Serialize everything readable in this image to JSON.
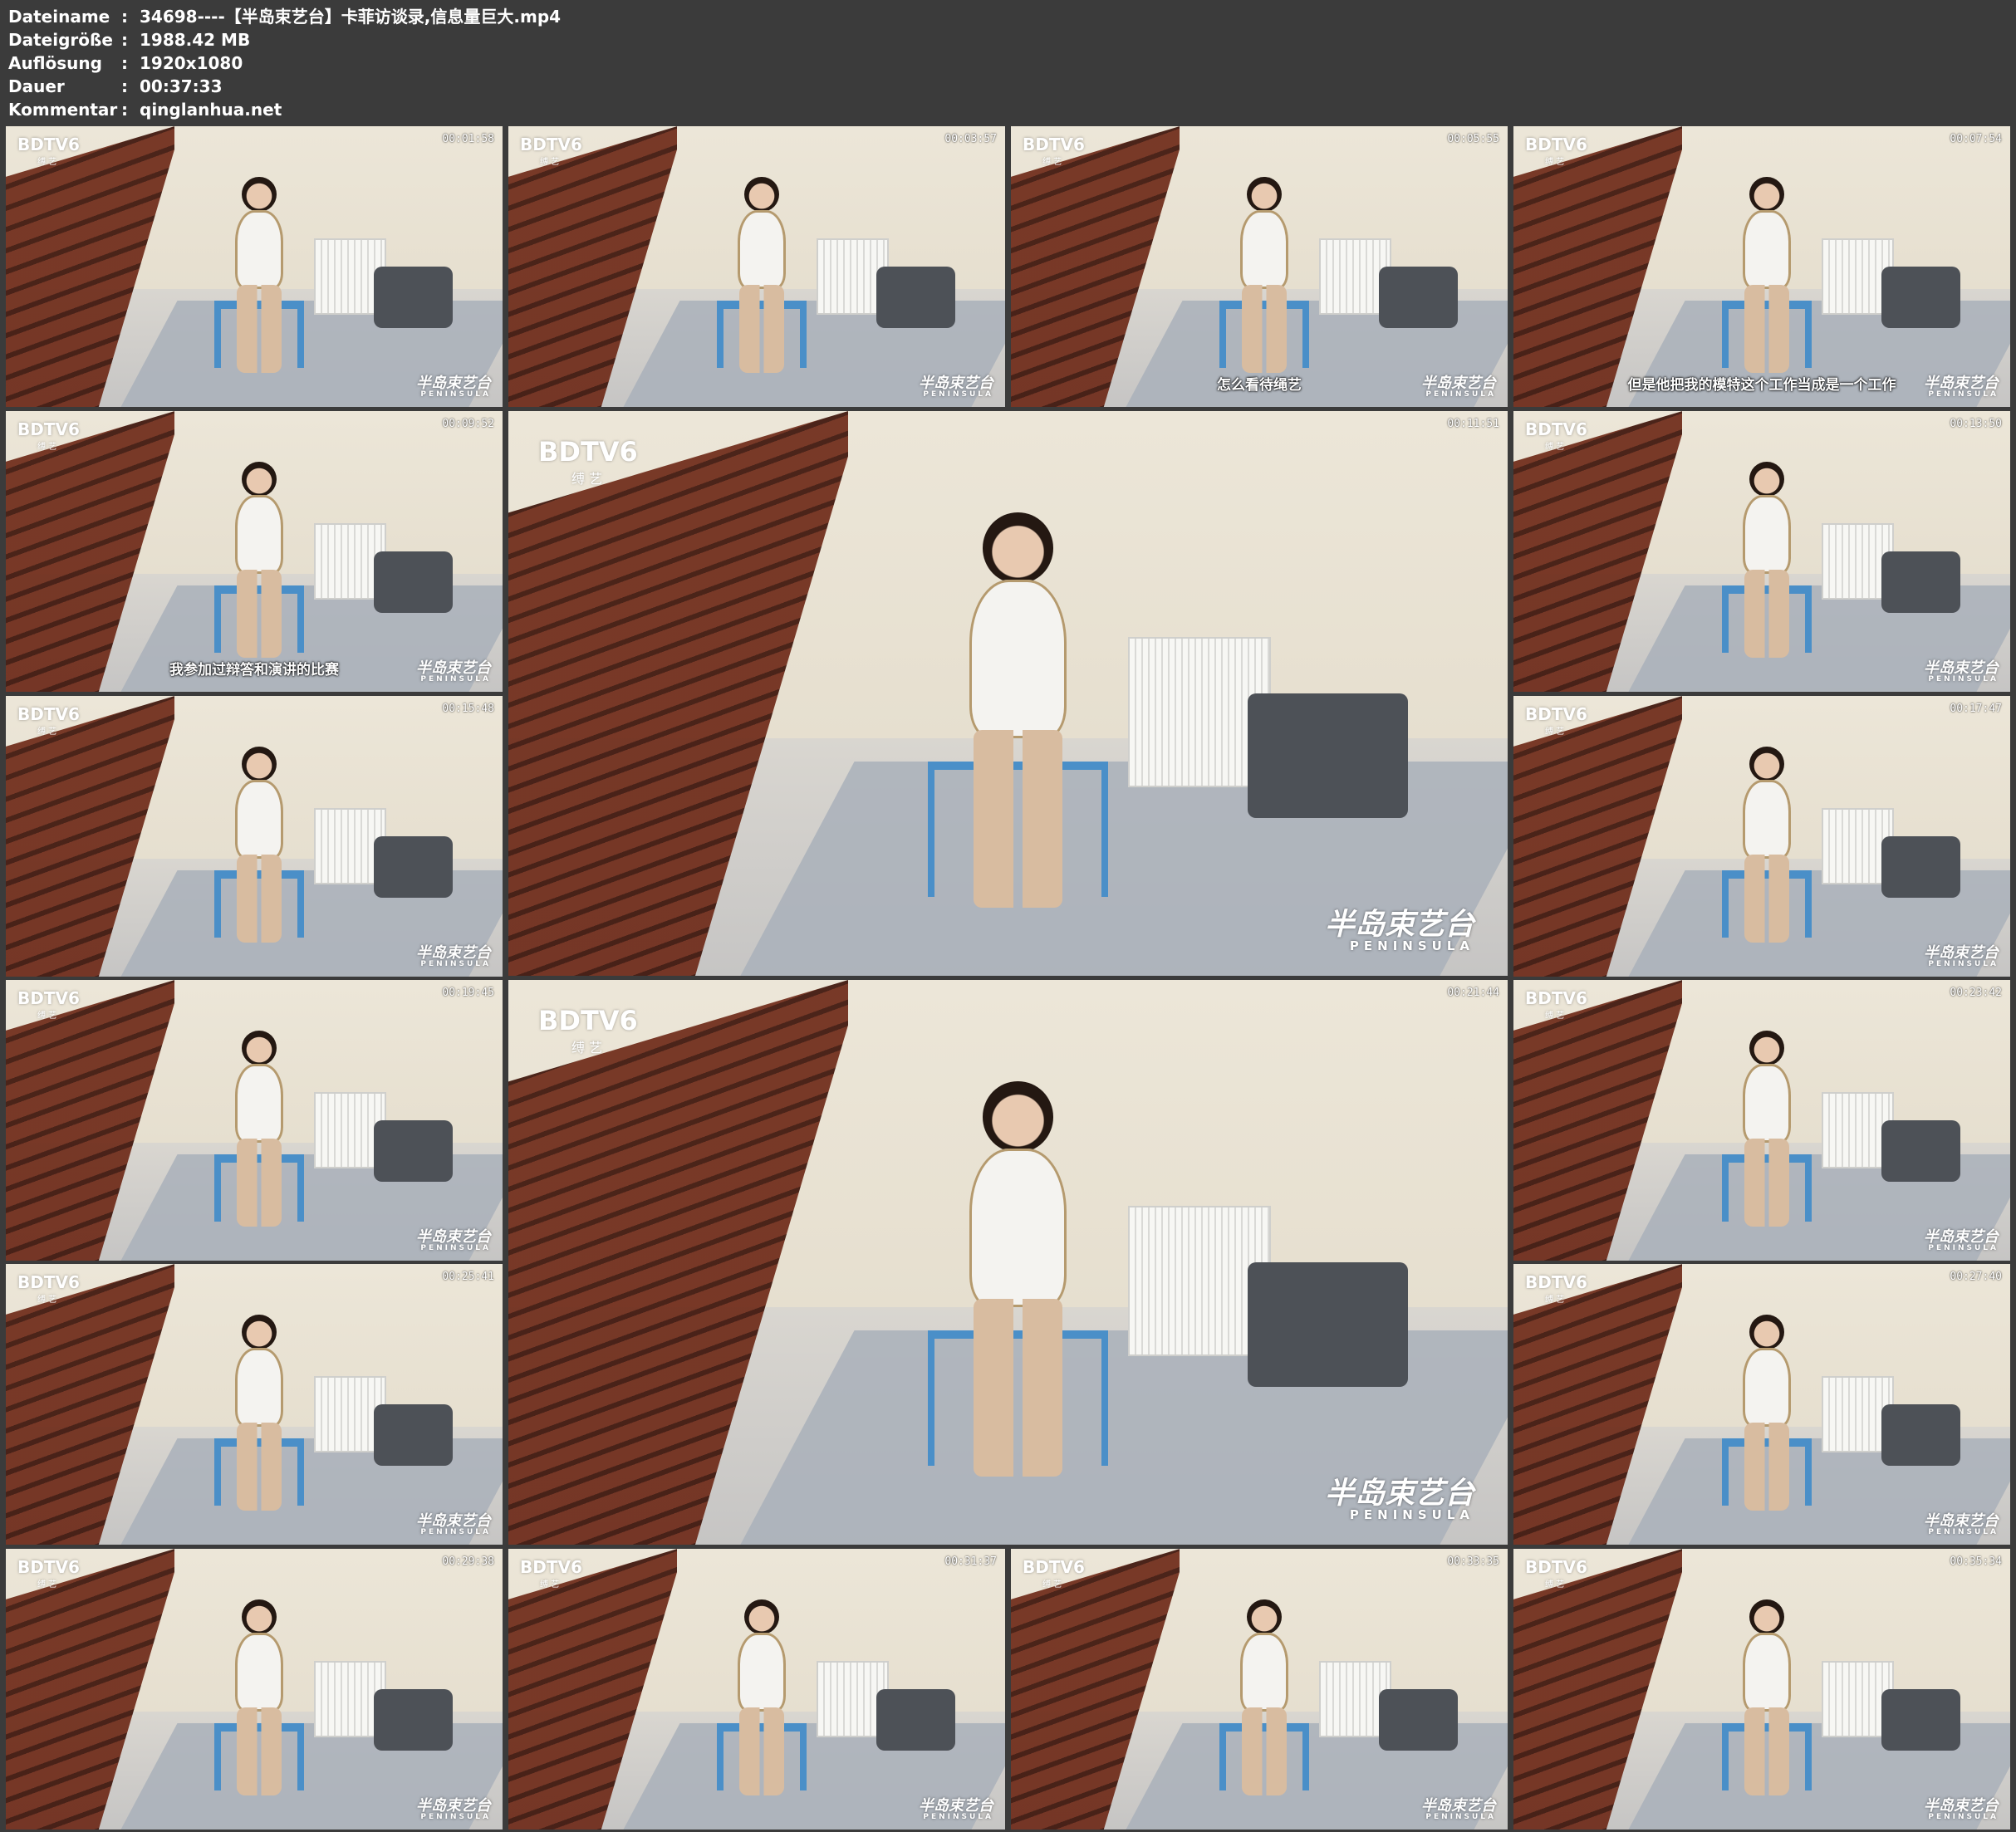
{
  "file_info": [
    {
      "key": "Dateiname",
      "value": "34698----【半岛束艺台】卡菲访谈录,信息量巨大.mp4"
    },
    {
      "key": "Dateigröße",
      "value": "1988.42 MB"
    },
    {
      "key": "Auflösung",
      "value": "1920x1080"
    },
    {
      "key": "Dauer",
      "value": "00:37:33"
    },
    {
      "key": "Kommentar",
      "value": "qinglanhua.net"
    }
  ],
  "watermark": {
    "channel": "BDTV6",
    "channel_sub": "缚 艺",
    "brand": "半岛束艺台",
    "brand_sub": "PENINSULA"
  },
  "thumbnails": [
    {
      "timestamp": "00:01:58",
      "subtitle": ""
    },
    {
      "timestamp": "00:03:57",
      "subtitle": ""
    },
    {
      "timestamp": "00:05:55",
      "subtitle": "怎么看待绳艺"
    },
    {
      "timestamp": "00:07:54",
      "subtitle": "但是他把我的模特这个工作当成是一个工作"
    },
    {
      "timestamp": "00:09:52",
      "subtitle": "我参加过辩答和演讲的比赛"
    },
    {
      "timestamp": "00:11:51",
      "subtitle": ""
    },
    {
      "timestamp": "00:13:50",
      "subtitle": ""
    },
    {
      "timestamp": "00:15:48",
      "subtitle": ""
    },
    {
      "timestamp": "00:17:47",
      "subtitle": ""
    },
    {
      "timestamp": "00:19:45",
      "subtitle": ""
    },
    {
      "timestamp": "00:21:44",
      "subtitle": ""
    },
    {
      "timestamp": "00:23:42",
      "subtitle": ""
    },
    {
      "timestamp": "00:25:41",
      "subtitle": ""
    },
    {
      "timestamp": "00:27:40",
      "subtitle": ""
    },
    {
      "timestamp": "00:29:38",
      "subtitle": ""
    },
    {
      "timestamp": "00:31:37",
      "subtitle": ""
    },
    {
      "timestamp": "00:33:35",
      "subtitle": ""
    },
    {
      "timestamp": "00:35:34",
      "subtitle": ""
    }
  ]
}
